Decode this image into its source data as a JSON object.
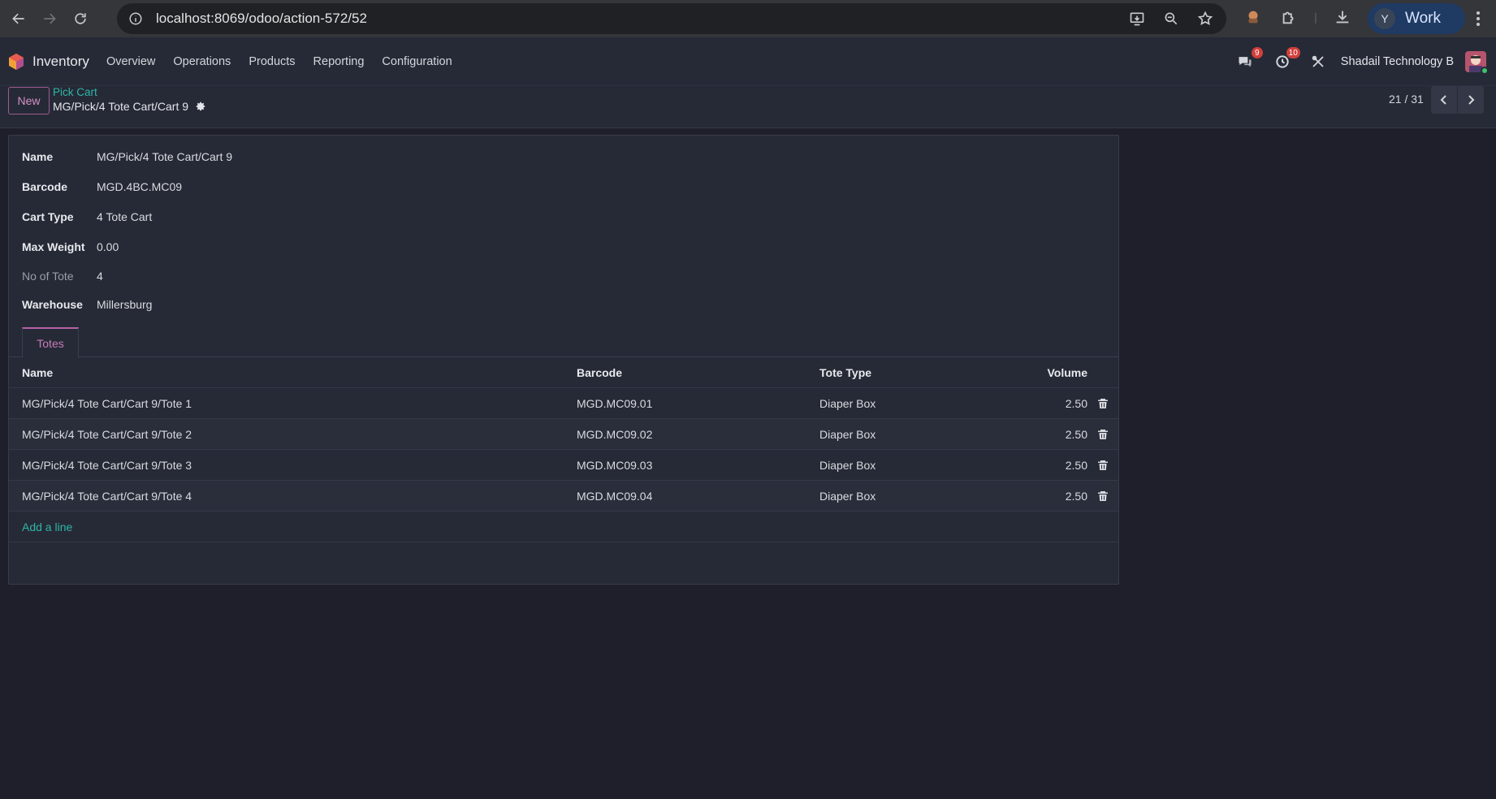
{
  "browser": {
    "url": "localhost:8069/odoo/action-572/52",
    "profile_initial": "Y",
    "profile_name": "Work"
  },
  "navbar": {
    "app_name": "Inventory",
    "menu": [
      "Overview",
      "Operations",
      "Products",
      "Reporting",
      "Configuration"
    ],
    "messages_count": "9",
    "activities_count": "10",
    "company": "Shadail Technology B"
  },
  "control": {
    "new_label": "New",
    "breadcrumb_parent": "Pick Cart",
    "breadcrumb_current": "MG/Pick/4 Tote Cart/Cart 9",
    "pager": "21 / 31"
  },
  "form": {
    "fields": [
      {
        "label": "Name",
        "value": "MG/Pick/4 Tote Cart/Cart 9"
      },
      {
        "label": "Barcode",
        "value": "MGD.4BC.MC09"
      },
      {
        "label": "Cart Type",
        "value": "4 Tote Cart"
      },
      {
        "label": "Max Weight",
        "value": "0.00"
      },
      {
        "label": "No of Tote",
        "value": "4"
      },
      {
        "label": "Warehouse",
        "value": "Millersburg"
      }
    ],
    "tab_label": "Totes",
    "columns": {
      "name": "Name",
      "barcode": "Barcode",
      "type": "Tote Type",
      "volume": "Volume"
    },
    "rows": [
      {
        "name": "MG/Pick/4 Tote Cart/Cart 9/Tote 1",
        "barcode": "MGD.MC09.01",
        "type": "Diaper Box",
        "volume": "2.50"
      },
      {
        "name": "MG/Pick/4 Tote Cart/Cart 9/Tote 2",
        "barcode": "MGD.MC09.02",
        "type": "Diaper Box",
        "volume": "2.50"
      },
      {
        "name": "MG/Pick/4 Tote Cart/Cart 9/Tote 3",
        "barcode": "MGD.MC09.03",
        "type": "Diaper Box",
        "volume": "2.50"
      },
      {
        "name": "MG/Pick/4 Tote Cart/Cart 9/Tote 4",
        "barcode": "MGD.MC09.04",
        "type": "Diaper Box",
        "volume": "2.50"
      }
    ],
    "add_line": "Add a line"
  }
}
